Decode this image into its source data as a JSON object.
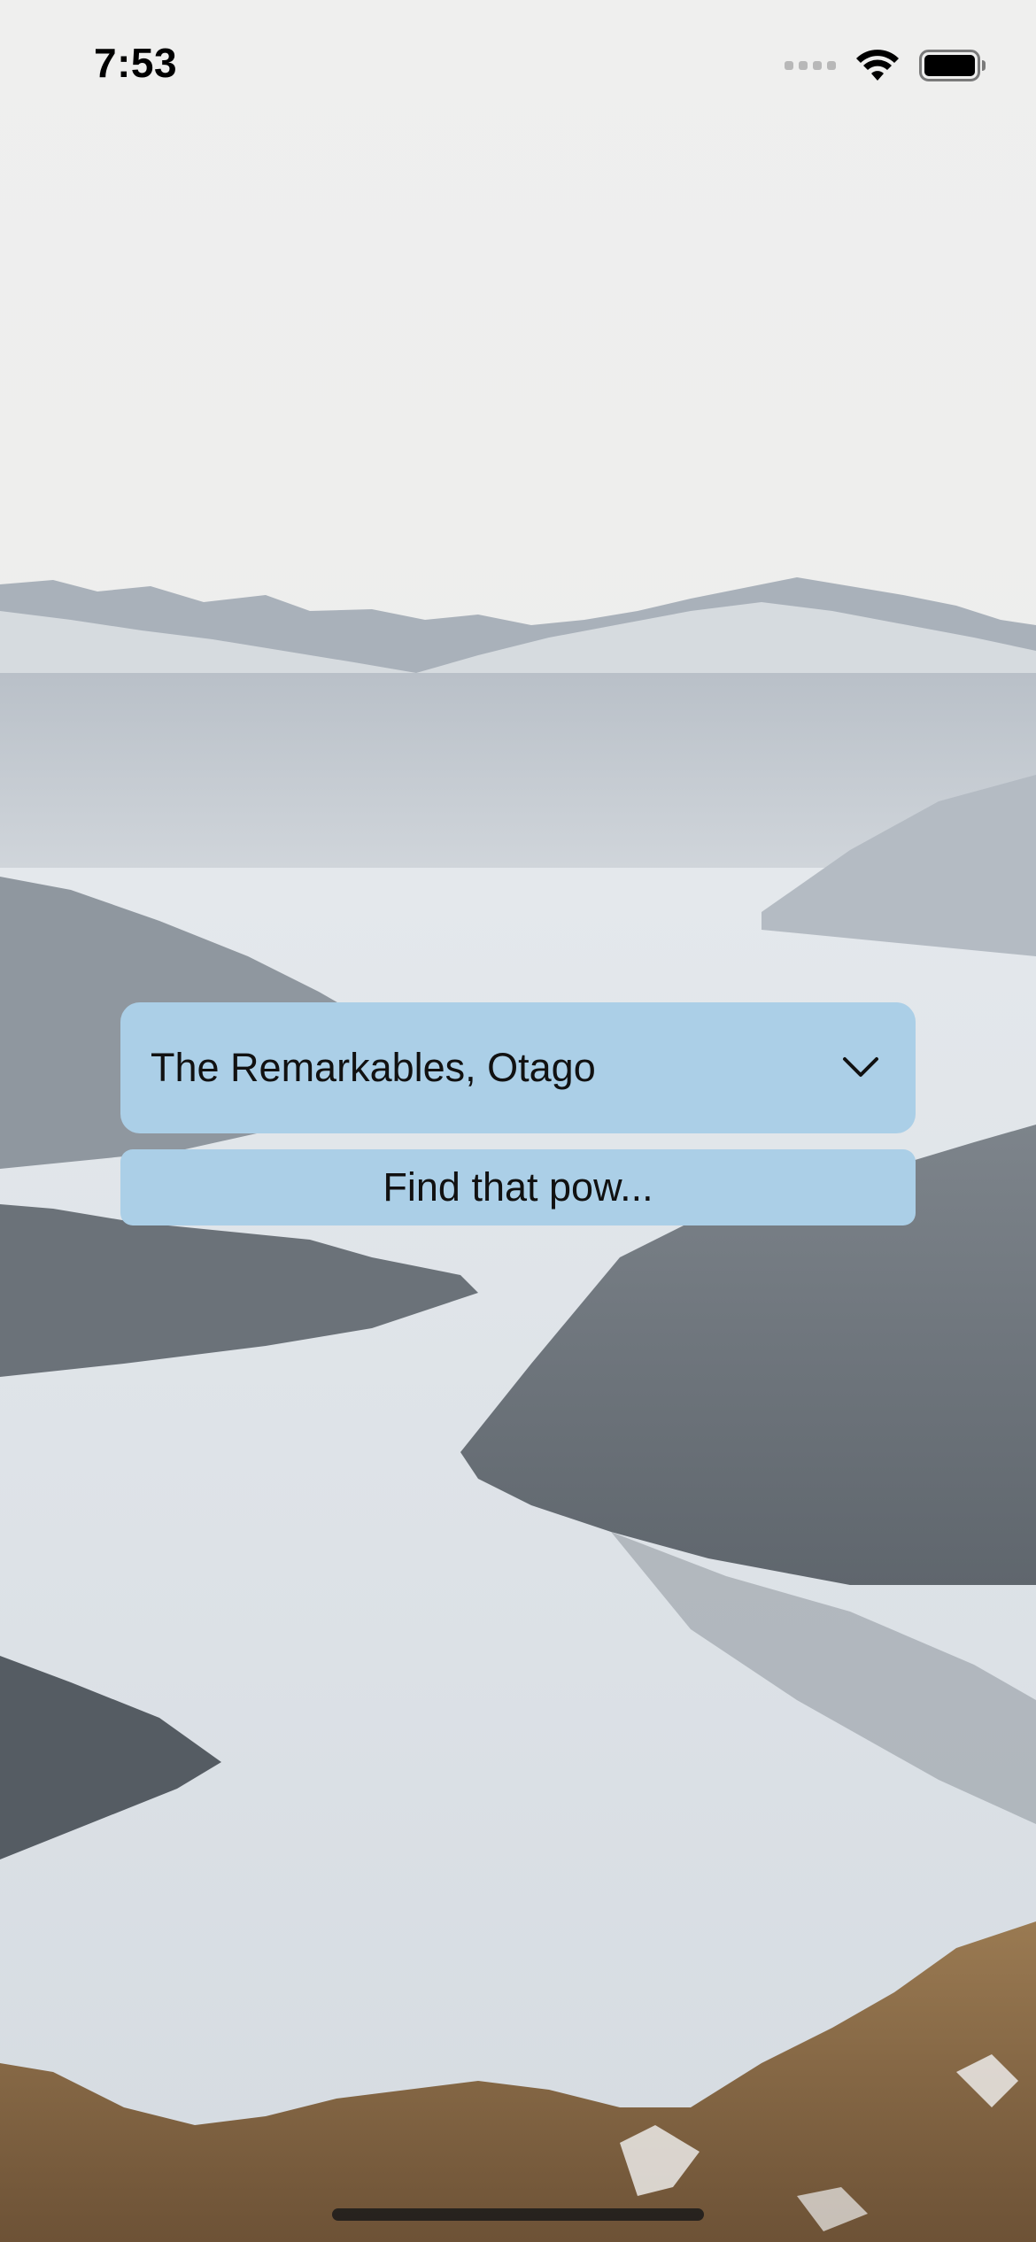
{
  "status_bar": {
    "time": "7:53"
  },
  "location_picker": {
    "selected": "The Remarkables, Otago"
  },
  "find_button": {
    "label": "Find that pow..."
  },
  "icons": {
    "picker_chevron": "chevron-down-icon",
    "signal": "cellular-signal-icon",
    "wifi": "wifi-icon",
    "battery": "battery-icon"
  },
  "colors": {
    "control_background": "#abcfe7",
    "control_text": "#111111",
    "sky": "#eeeeed",
    "lake": "#dfe4ea",
    "hills": "#626a72",
    "brush": "#8a6a45"
  }
}
